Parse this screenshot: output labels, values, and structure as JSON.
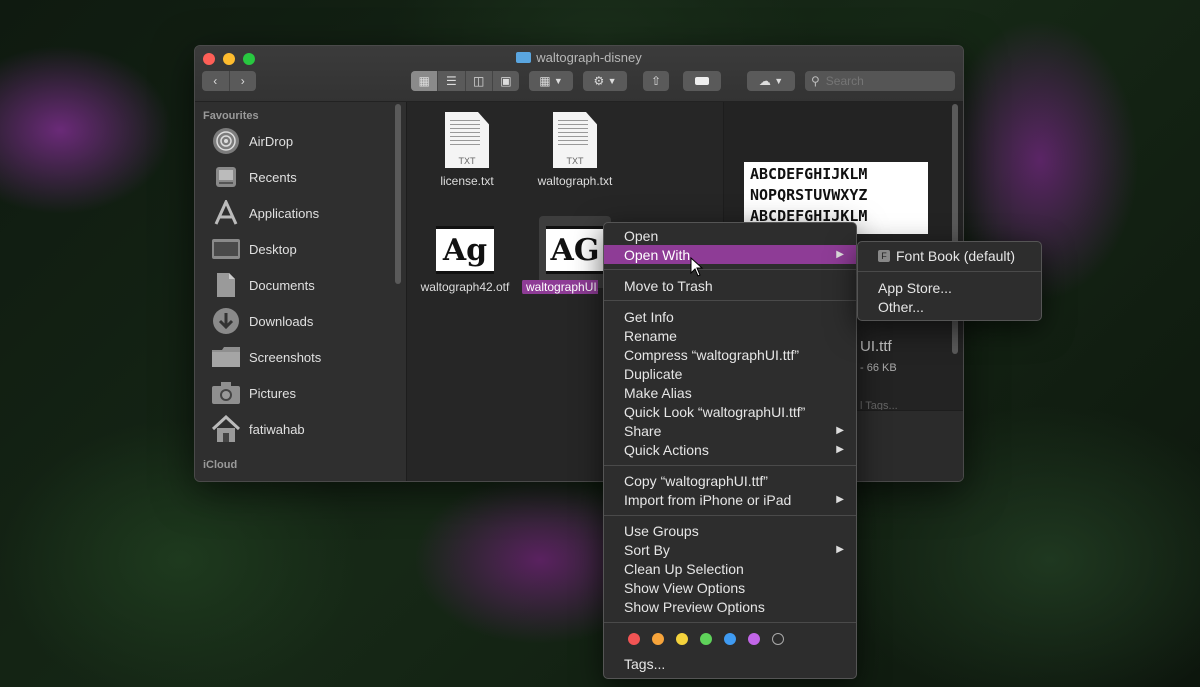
{
  "window": {
    "title": "waltograph-disney",
    "search_placeholder": "Search"
  },
  "sidebar": {
    "favourites_header": "Favourites",
    "icloud_header": "iCloud",
    "items": [
      {
        "label": "AirDrop",
        "icon": "airdrop-icon"
      },
      {
        "label": "Recents",
        "icon": "recents-icon"
      },
      {
        "label": "Applications",
        "icon": "applications-icon"
      },
      {
        "label": "Desktop",
        "icon": "desktop-icon"
      },
      {
        "label": "Documents",
        "icon": "documents-icon"
      },
      {
        "label": "Downloads",
        "icon": "downloads-icon"
      },
      {
        "label": "Screenshots",
        "icon": "folder-icon"
      },
      {
        "label": "Pictures",
        "icon": "camera-icon"
      },
      {
        "label": "fatiwahab",
        "icon": "home-icon"
      }
    ]
  },
  "files": [
    {
      "name": "license.txt",
      "ext": "TXT"
    },
    {
      "name": "waltograph.txt",
      "ext": "TXT"
    },
    {
      "name": "waltograph42.otf",
      "glyph": "Ag"
    },
    {
      "name": "waltographUI.ttf",
      "glyph": "AG",
      "selected": true
    }
  ],
  "preview": {
    "sample_line1": "ABCDEFGHIJKLM",
    "sample_line2": "NOPQRSTUVWXYZ",
    "sample_line3": "ABCDEFGHIJKLM",
    "name_fragment": "UI.ttf",
    "size_fragment": "- 66 KB",
    "tags_fragment": "l Tags..."
  },
  "context_menu": {
    "open": "Open",
    "open_with": "Open With",
    "move_to_trash": "Move to Trash",
    "get_info": "Get Info",
    "rename": "Rename",
    "compress": "Compress “waltographUI.ttf”",
    "duplicate": "Duplicate",
    "make_alias": "Make Alias",
    "quick_look": "Quick Look “waltographUI.ttf”",
    "share": "Share",
    "quick_actions": "Quick Actions",
    "copy": "Copy “waltographUI.ttf”",
    "import_iphone": "Import from iPhone or iPad",
    "use_groups": "Use Groups",
    "sort_by": "Sort By",
    "clean_up": "Clean Up Selection",
    "show_view_options": "Show View Options",
    "show_preview_options": "Show Preview Options",
    "tags": "Tags...",
    "tag_colors": [
      "#f25454",
      "#f7a43b",
      "#f5d33c",
      "#5fd35a",
      "#3f9bf2",
      "#c266e8"
    ]
  },
  "submenu": {
    "font_book": "Font Book (default)",
    "app_store": "App Store...",
    "other": "Other..."
  },
  "colors": {
    "highlight": "#8e3c96"
  }
}
